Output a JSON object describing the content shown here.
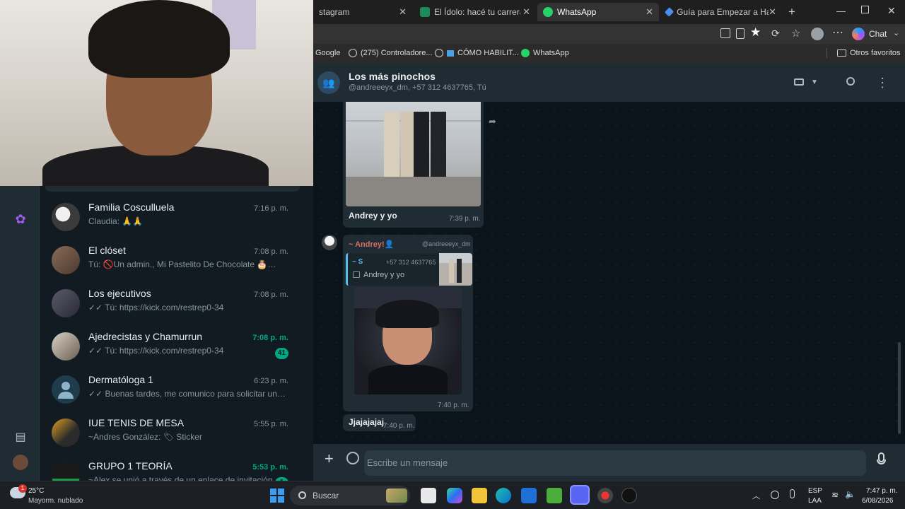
{
  "browser": {
    "tabs": [
      {
        "label": "stagram",
        "active": false
      },
      {
        "label": "El Ídolo: hacé tu carrera en la U",
        "active": false
      },
      {
        "label": "WhatsApp",
        "active": true
      },
      {
        "label": "Guía para Empezar a Hacer Str",
        "active": false
      }
    ],
    "copilot_label": "Chat",
    "bookmarks": [
      "Google",
      "(275) Controladore...",
      "CÓMO HABILIT...",
      "WhatsApp"
    ],
    "other_bookmarks": "Otros favoritos"
  },
  "chat_list": [
    {
      "name": "Familia Cosculluela",
      "preview": "Claudia: 🙏🙏",
      "time": "7:16 p. m.",
      "unread": null,
      "avatar_color": "#3b3b3b"
    },
    {
      "name": "El clóset",
      "preview": "Tú: 🚫Un admin., Mi Pastelito De Chocolate 🎂🍫, eli...",
      "time": "7:08 p. m.",
      "unread": null,
      "avatar_color": "#6b5647"
    },
    {
      "name": "Los ejecutivos",
      "preview": "✓✓ Tú: https://kick.com/restrep0-34",
      "time": "7:08 p. m.",
      "unread": null,
      "avatar_color": "#4a4a5a"
    },
    {
      "name": "Ajedrecistas y Chamurrun",
      "preview": "✓✓ Tú: https://kick.com/restrep0-34",
      "time": "7:08 p. m.",
      "unread": "41",
      "avatar_color": "#7a6b5e"
    },
    {
      "name": "Dermatóloga 1",
      "preview": "✓✓ Buenas tardes, me comunico para solicitar una cita...",
      "time": "6:23 p. m.",
      "unread": null,
      "avatar_color": "#1f3c4d"
    },
    {
      "name": "IUE TENIS DE MESA",
      "preview": "~Andres González: 🏷 Sticker",
      "time": "5:55 p. m.",
      "unread": null,
      "avatar_color": "#2b2b2b"
    },
    {
      "name": "GRUPO 1 TEORÍA",
      "preview": "~Alex se unió a través de un enlace de invitación",
      "time": "5:53 p. m.",
      "unread": "1",
      "avatar_color": "#1a1a1a"
    }
  ],
  "chat": {
    "group_name": "Los más pinochos",
    "members": "@andreeeyx_dm, +57 312 4637765, Tú",
    "messages": {
      "m1": {
        "caption": "Andrey y yo",
        "time": "7:39 p. m."
      },
      "m2": {
        "sender": "~ Andrey!👤",
        "handle": "@andreeeyx_dm",
        "quote_author": "~ S",
        "quote_phone": "+57 312 4637765",
        "quote_text": "Andrey y yo",
        "time": "7:40 p. m."
      },
      "m3": {
        "text": "Jjajajajaj",
        "time": "7:40 p. m."
      }
    },
    "compose_placeholder": "Escribe un mensaje"
  },
  "taskbar": {
    "weather_temp": "25°C",
    "weather_desc": "Mayorm. nublado",
    "weather_badge": "1",
    "search_label": "Buscar",
    "lang": "ESP",
    "lang2": "LAA",
    "time": "7:47 p. m.",
    "date": "6/08/2026"
  },
  "colors": {
    "accent": "#00a884",
    "sender_name": "#e06c5c"
  }
}
